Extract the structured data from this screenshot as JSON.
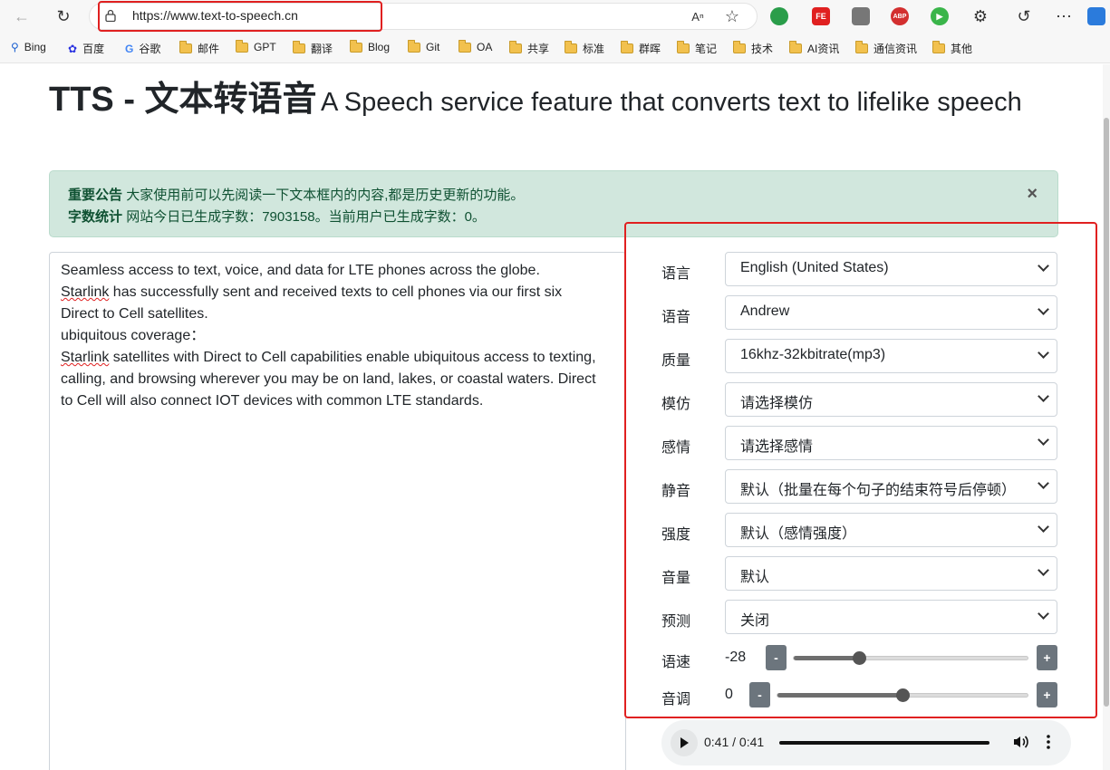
{
  "browser": {
    "url": "https://www.text-to-speech.cn"
  },
  "bookmarks": [
    {
      "label": "Bing",
      "icon": "search-icon"
    },
    {
      "label": "百度",
      "icon": "baidu-icon"
    },
    {
      "label": "谷歌",
      "icon": "google-icon"
    },
    {
      "label": "邮件",
      "icon": "folder-icon"
    },
    {
      "label": "GPT",
      "icon": "folder-icon"
    },
    {
      "label": "翻译",
      "icon": "folder-icon"
    },
    {
      "label": "Blog",
      "icon": "folder-icon"
    },
    {
      "label": "Git",
      "icon": "folder-icon"
    },
    {
      "label": "OA",
      "icon": "folder-icon"
    },
    {
      "label": "共享",
      "icon": "folder-icon"
    },
    {
      "label": "标准",
      "icon": "folder-icon"
    },
    {
      "label": "群晖",
      "icon": "folder-icon"
    },
    {
      "label": "笔记",
      "icon": "folder-icon"
    },
    {
      "label": "技术",
      "icon": "folder-icon"
    },
    {
      "label": "AI资讯",
      "icon": "folder-icon"
    },
    {
      "label": "通信资讯",
      "icon": "folder-icon"
    },
    {
      "label": "其他",
      "icon": "folder-icon"
    }
  ],
  "page": {
    "title": "TTS - 文本转语音",
    "subtitle": "A Speech service feature that converts text to lifelike speech"
  },
  "alert": {
    "line1_label": "重要公告",
    "line1_text": "大家使用前可以先阅读一下文本框内的内容,都是历史更新的功能。",
    "line2_label": "字数统计",
    "line2_text": "网站今日已生成字数：7903158。当前用户已生成字数：0。",
    "close": "×"
  },
  "text_input": {
    "l1": "Seamless access to text, voice, and data for LTE phones across the globe.",
    "l2a": "Starlink",
    "l2b": " has successfully sent and received texts to cell phones via our first six",
    "l3": "Direct to Cell satellites.",
    "l4": "ubiquitous coverage：",
    "l5a": "Starlink",
    "l5b": " satellites with Direct to Cell capabilities enable ubiquitous access to texting,",
    "l6": "calling, and browsing wherever you may be on land, lakes, or coastal waters. Direct",
    "l7": "to Cell will also connect IOT devices with common LTE standards."
  },
  "settings": {
    "language": {
      "label": "语言",
      "value": "English (United States)"
    },
    "voice": {
      "label": "语音",
      "value": "Andrew"
    },
    "quality": {
      "label": "质量",
      "value": "16khz-32kbitrate(mp3)"
    },
    "style": {
      "label": "模仿",
      "value": "请选择模仿"
    },
    "emotion": {
      "label": "感情",
      "value": "请选择感情"
    },
    "silence": {
      "label": "静音",
      "value": "默认（批量在每个句子的结束符号后停顿）"
    },
    "intensity": {
      "label": "强度",
      "value": "默认（感情强度）"
    },
    "volume": {
      "label": "音量",
      "value": "默认"
    },
    "preview": {
      "label": "预测",
      "value": "关闭"
    },
    "rate": {
      "label": "语速",
      "value": "-28",
      "minus": "-",
      "plus": "+",
      "level": 0.28
    },
    "pitch": {
      "label": "音调",
      "value": "0",
      "minus": "-",
      "plus": "+",
      "level": 0.5
    }
  },
  "audio": {
    "time": "0:41 / 0:41",
    "progress": 1.0
  },
  "colors": {
    "highlight": "#e02020",
    "alert_bg": "#d1e7dd",
    "alert_text": "#0f5132",
    "button_gray": "#6c757d"
  }
}
